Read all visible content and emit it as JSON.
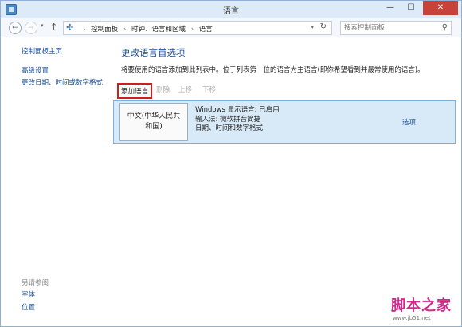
{
  "window": {
    "title": "语言",
    "min_glyph": "—",
    "max_glyph": "☐",
    "close_glyph": "✕"
  },
  "address": {
    "back_glyph": "←",
    "forward_glyph": "→",
    "recent_glyph": "▾",
    "up_glyph": "↑",
    "breadcrumbs": [
      "控制面板",
      "时钟、语言和区域",
      "语言"
    ],
    "separator": "›",
    "dropdown_glyph": "▾",
    "refresh_glyph": "↻",
    "search_placeholder": "搜索控制面板",
    "search_glyph": "⚲"
  },
  "sidebar": {
    "home": "控制面板主页",
    "items": [
      "高级设置",
      "更改日期、时间或数字格式"
    ],
    "see_also_label": "另请参阅",
    "see_also": [
      "字体",
      "位置"
    ]
  },
  "main": {
    "heading": "更改语言首选项",
    "description": "将要使用的语言添加到此列表中。位于列表第一位的语言为主语言(即你希望看到并最常使用的语言)。",
    "toolbar": {
      "add": "添加语言",
      "remove": "删除",
      "up": "上移",
      "down": "下移"
    },
    "languages": [
      {
        "name_line1": "中文(中华人民共",
        "name_line2": "和国)",
        "display": "Windows 显示语言: 已启用",
        "input": "输入法: 微软拼音简捷",
        "format": "日期、时间和数字格式",
        "options": "选项"
      }
    ]
  },
  "watermark": {
    "brand": "脚本之家",
    "site": "www.jb51.net"
  }
}
